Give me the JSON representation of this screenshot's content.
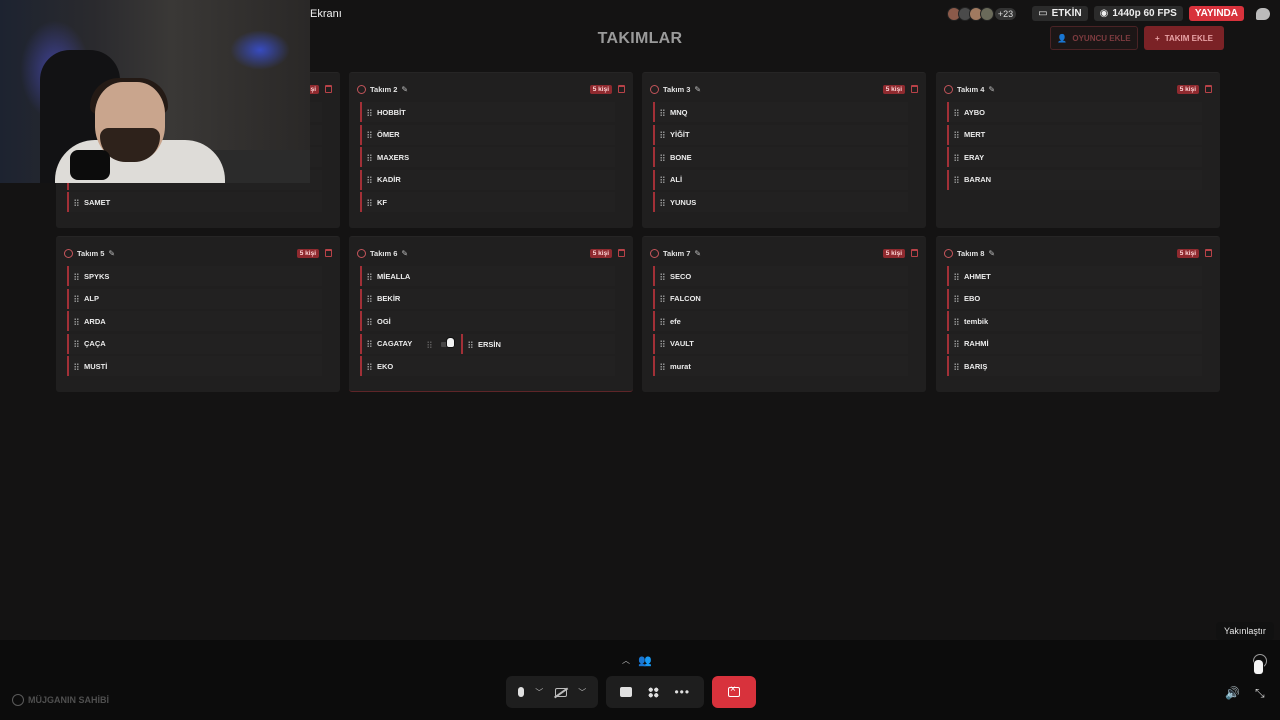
{
  "window": {
    "title": "Ekranı"
  },
  "status": {
    "viewer_extra": "+23",
    "activity": "ETKİN",
    "quality": "1440p 60 FPS",
    "live": "YAYINDA"
  },
  "page": {
    "title": "TAKIMLAR",
    "add_player": "OYUNCU EKLE",
    "add_team": "TAKIM EKLE"
  },
  "teams": [
    {
      "name": "",
      "count": "5 kişi",
      "players": [
        "",
        "",
        "",
        "",
        "SAMET"
      ]
    },
    {
      "name": "Takım 2",
      "count": "5 kişi",
      "players": [
        "HOBBİT",
        "ÖMER",
        "MAXERS",
        "KADİR",
        "KF"
      ]
    },
    {
      "name": "Takım 3",
      "count": "5 kişi",
      "players": [
        "MNQ",
        "YİĞİT",
        "BONE",
        "ALİ",
        "YUNUS"
      ]
    },
    {
      "name": "Takım 4",
      "count": "5 kişi",
      "players": [
        "AYBO",
        "MERT",
        "ERAY",
        "BARAN"
      ]
    },
    {
      "name": "Takım 5",
      "count": "5 kişi",
      "players": [
        "SPYKS",
        "ALP",
        "ARDA",
        "ÇAÇA",
        "MUSTİ"
      ]
    },
    {
      "name": "Takım 6",
      "count": "5 kişi",
      "players": [
        "MİEALLA",
        "BEKİR",
        "OGİ",
        "CAGATAY",
        "EKO"
      ]
    },
    {
      "name": "Takım 7",
      "count": "5 kişi",
      "players": [
        "SECO",
        "FALCON",
        "efe",
        "VAULT",
        "murat"
      ]
    },
    {
      "name": "Takım 8",
      "count": "5 kişi",
      "players": [
        "AHMET",
        "EBO",
        "tembik",
        "RAHMİ",
        "BARIŞ"
      ]
    }
  ],
  "dragging": {
    "player": "ERSİN"
  },
  "controls": {
    "owner_label": "MÜJGANIN SAHİBİ",
    "tooltip": "Yakınlaştır"
  },
  "colors": {
    "accent": "#d8323c",
    "card": "#201f1f",
    "background": "#141313"
  }
}
